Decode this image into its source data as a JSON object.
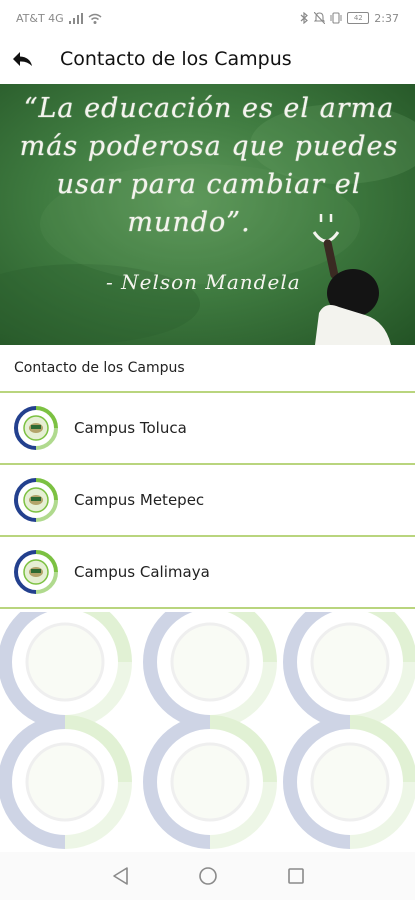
{
  "status_bar": {
    "carrier": "AT&T 4G",
    "time": "2:37",
    "battery": "42"
  },
  "app_bar": {
    "title": "Contacto de los Campus",
    "back_icon": "back-arrow-icon"
  },
  "hero": {
    "quote_line_1": "“La educación es el arma",
    "quote_line_2": "más poderosa que puedes",
    "quote_line_3": "usar para cambiar el",
    "quote_line_4": "mundo”.",
    "author": "- Nelson Mandela"
  },
  "section": {
    "title": "Contacto de los Campus"
  },
  "campuses": [
    {
      "label": "Campus Toluca"
    },
    {
      "label": "Campus Metepec"
    },
    {
      "label": "Campus Calimaya"
    }
  ],
  "colors": {
    "divider": "#b9d57e",
    "logo_green": "#7cc142",
    "logo_blue": "#23408e",
    "chalkboard": "#3f7b40"
  },
  "nav_bar": {
    "back": "triangle-back-icon",
    "home": "circle-home-icon",
    "recents": "square-recents-icon"
  }
}
